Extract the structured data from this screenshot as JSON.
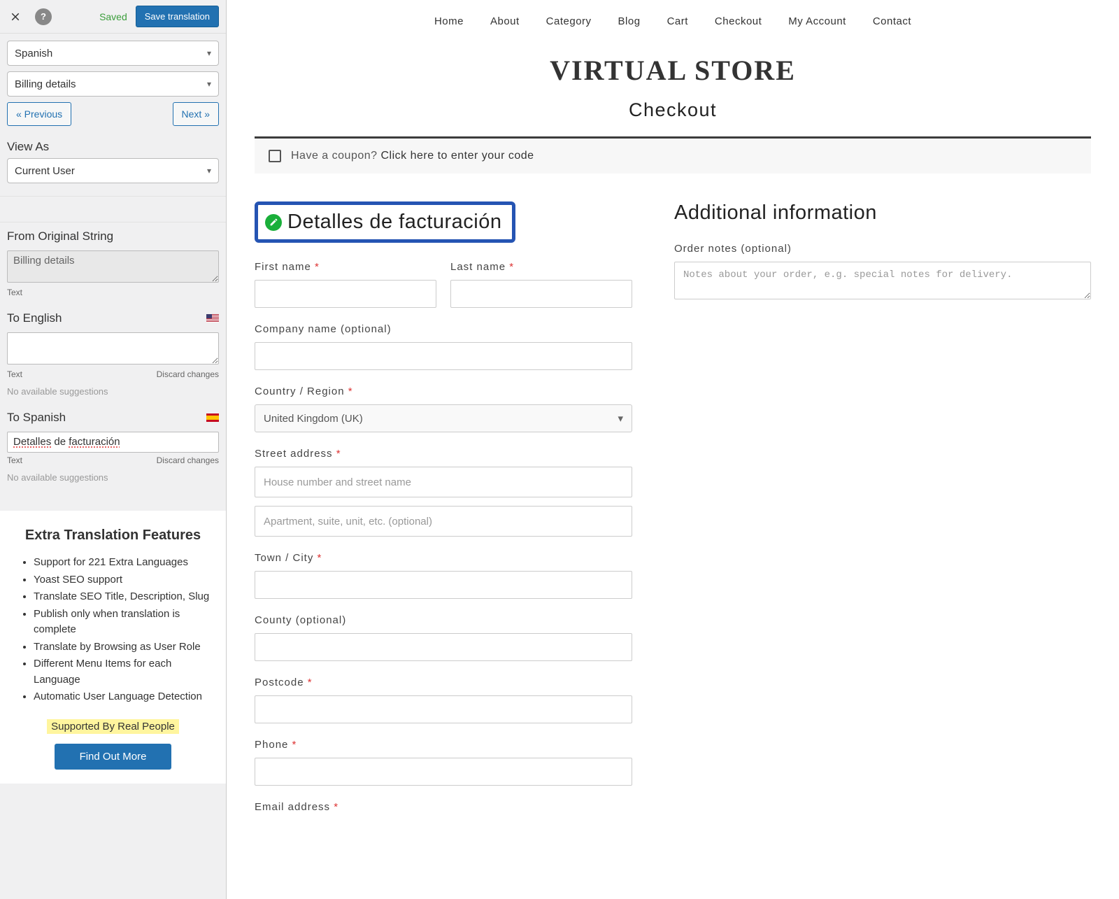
{
  "sidebar": {
    "saved_text": "Saved",
    "save_btn": "Save translation",
    "lang_select": "Spanish",
    "string_select": "Billing details",
    "prev_btn": "« Previous",
    "next_btn": "Next »",
    "view_as_label": "View As",
    "view_as_value": "Current User",
    "from_label": "From Original String",
    "from_value": "Billing details",
    "text_label": "Text",
    "to_en_label": "To English",
    "to_en_value": "",
    "discard": "Discard changes",
    "no_sugg": "No available suggestions",
    "to_es_label": "To Spanish",
    "to_es_value_1": "Detalles",
    "to_es_value_2": " de ",
    "to_es_value_3": "facturación",
    "extra": {
      "title": "Extra Translation Features",
      "items": [
        "Support for 221 Extra Languages",
        "Yoast SEO support",
        "Translate SEO Title, Description, Slug",
        "Publish only when translation is complete",
        "Translate by Browsing as User Role",
        "Different Menu Items for each Language",
        "Automatic User Language Detection"
      ],
      "supported": "Supported By Real People",
      "find_more": "Find Out More"
    }
  },
  "preview": {
    "nav": [
      "Home",
      "About",
      "Category",
      "Blog",
      "Cart",
      "Checkout",
      "My Account",
      "Contact"
    ],
    "store_title": "VIRTUAL STORE",
    "page_title": "Checkout",
    "coupon_q": "Have a coupon? ",
    "coupon_link": "Click here to enter your code",
    "billing_heading": "Detalles de facturación",
    "info_heading": "Additional information",
    "order_notes_label": "Order notes (optional)",
    "order_notes_placeholder": "Notes about your order, e.g. special notes for delivery.",
    "labels": {
      "first_name": "First name ",
      "last_name": "Last name ",
      "company": "Company name (optional)",
      "country": "Country / Region ",
      "country_value": "United Kingdom (UK)",
      "street": "Street address ",
      "street_ph1": "House number and street name",
      "street_ph2": "Apartment, suite, unit, etc. (optional)",
      "town": "Town / City ",
      "county": "County (optional)",
      "postcode": "Postcode ",
      "phone": "Phone ",
      "email": "Email address "
    }
  }
}
